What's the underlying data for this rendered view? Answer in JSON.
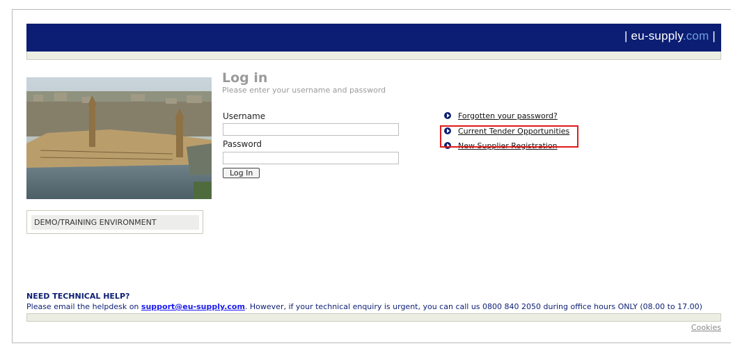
{
  "header": {
    "brand_main": "eu-supply",
    "brand_suffix": ".com",
    "pipe_left": "|",
    "pipe_right": "|"
  },
  "environment_label": "DEMO/TRAINING ENVIRONMENT",
  "login": {
    "title": "Log in",
    "subtitle": "Please enter your username and password",
    "username_label": "Username",
    "username_value": "",
    "password_label": "Password",
    "password_value": "",
    "submit_label": "Log In"
  },
  "links": [
    {
      "label": "Forgotten your password?",
      "icon": "arrow-circle-icon"
    },
    {
      "label": "Current Tender Opportunities",
      "icon": "arrow-circle-icon"
    },
    {
      "label": "New Supplier Registration",
      "icon": "arrow-circle-icon"
    }
  ],
  "help": {
    "title": "NEED TECHNICAL HELP?",
    "text_before": "Please email the helpdesk on ",
    "email": "support@eu-supply.com",
    "text_after": ". However, if your technical enquiry is urgent, you can call us 0800 840 2050 during office hours ONLY (08.00 to 17.00)"
  },
  "footer": {
    "cookies_label": "Cookies"
  },
  "colors": {
    "brand_navy": "#0c1e73",
    "highlight_red": "#e01b1b"
  }
}
